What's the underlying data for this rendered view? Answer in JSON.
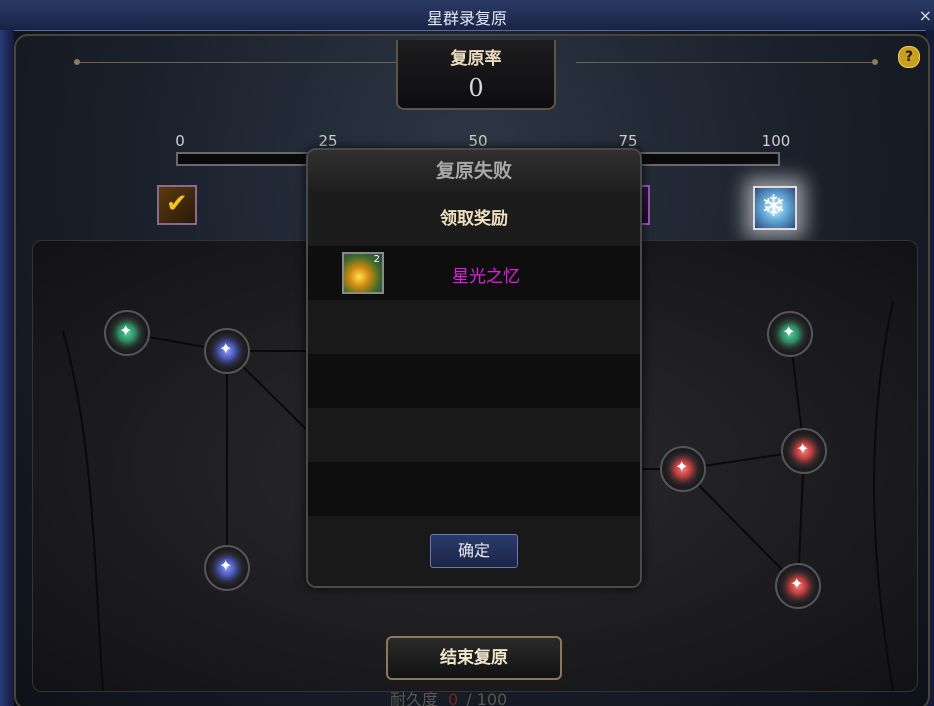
{
  "window": {
    "title": "星群录复原",
    "close_label": "×"
  },
  "rate": {
    "label": "复原率",
    "value": "0"
  },
  "help": {
    "label": "?"
  },
  "progress": {
    "ticks": [
      "0",
      "25",
      "50",
      "75",
      "100"
    ],
    "value": 0
  },
  "modal": {
    "title": "复原失败",
    "subtitle": "领取奖励",
    "reward": {
      "name": "星光之忆",
      "count": "2",
      "icon": "starlight-memory-icon"
    },
    "confirm_label": "确定"
  },
  "footer": {
    "end_label": "结束复原",
    "durability_label": "耐久度",
    "durability_current": "0",
    "durability_max": "/ 100"
  },
  "colors": {
    "reward_name": "#e020e0",
    "gold": "#c8a040"
  }
}
